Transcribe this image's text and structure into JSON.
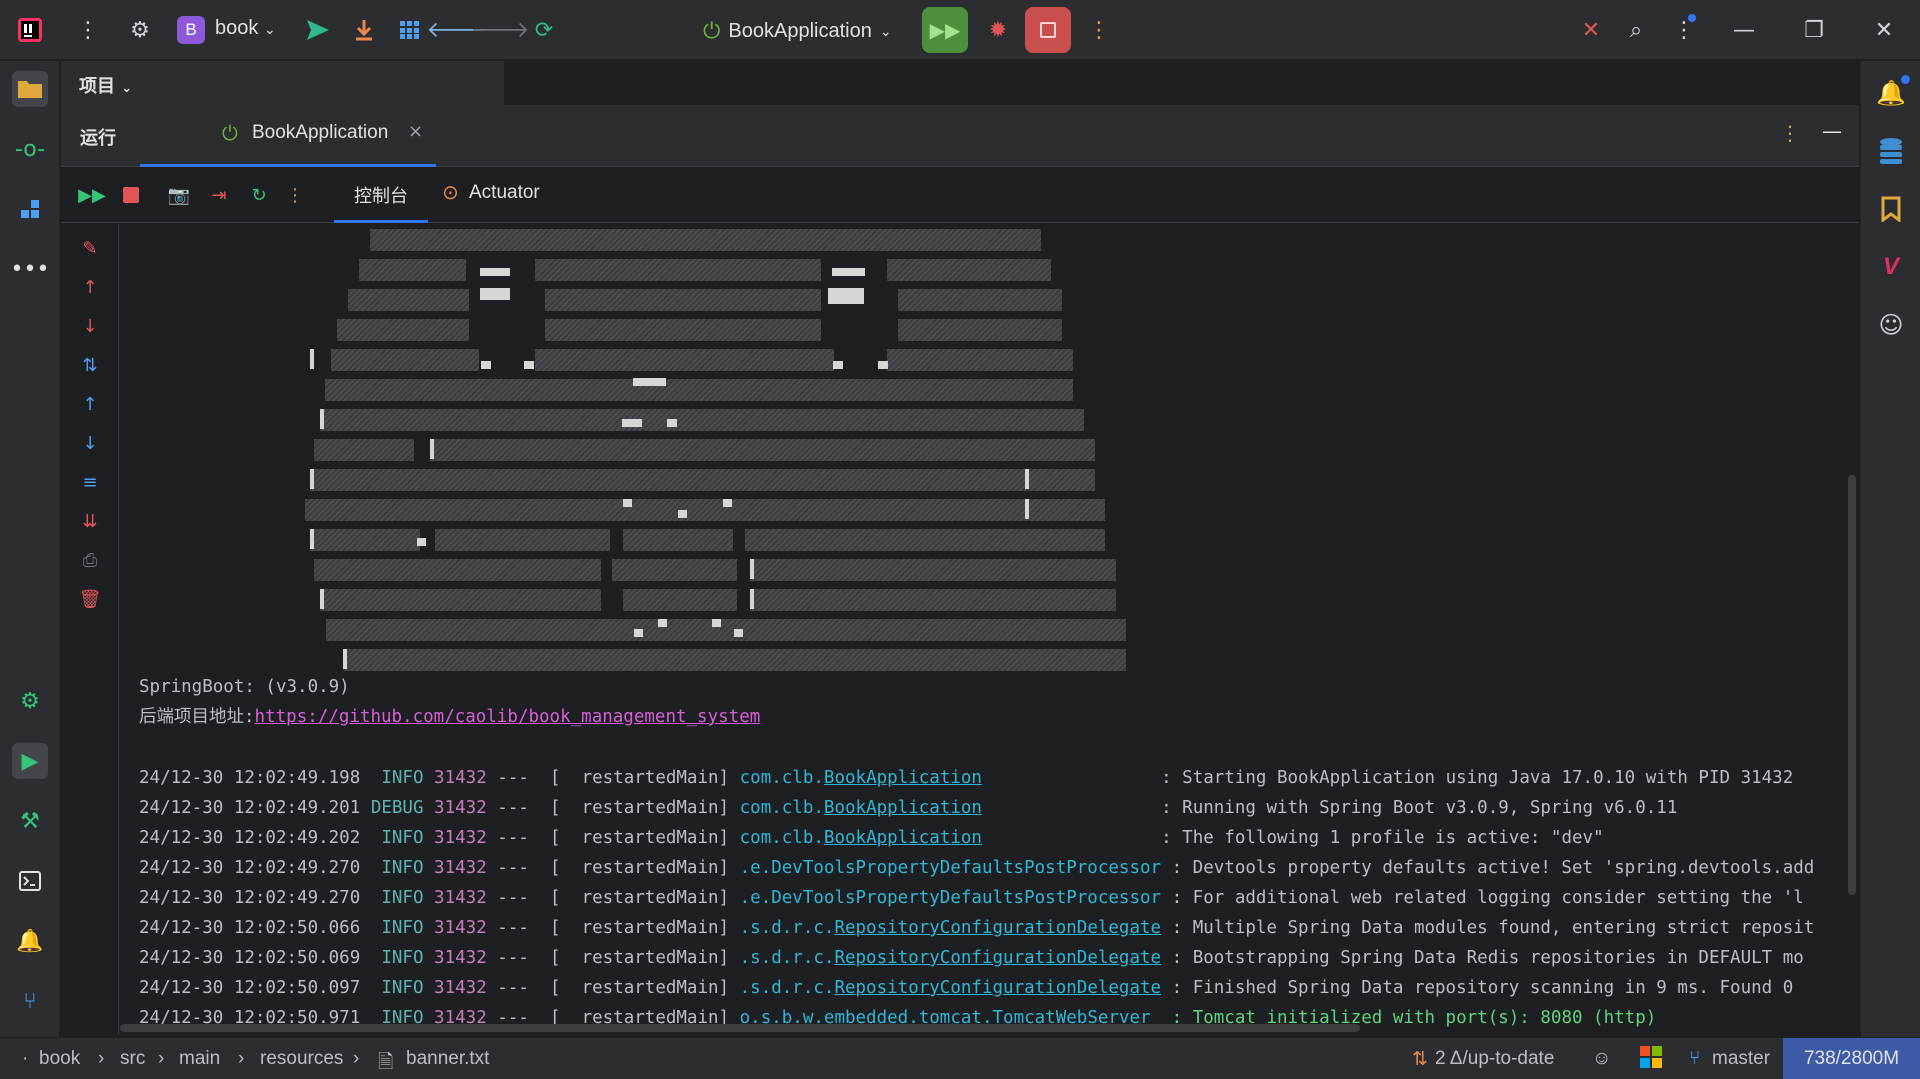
{
  "titlebar": {
    "project_initial": "B",
    "project_name": "book",
    "run_config": "BookApplication"
  },
  "project_panel": {
    "label": "项目"
  },
  "run_panel": {
    "label": "运行",
    "tab_label": "BookApplication",
    "tab_close": "×"
  },
  "console_tabs": {
    "console": "控制台",
    "actuator": "Actuator"
  },
  "console": {
    "springboot_line": "SpringBoot: (v3.0.9)",
    "backend_label": "后端项目地址:",
    "backend_url": "https://github.com/caolib/book_management_system",
    "log_lines": [
      {
        "ts": "24/12-30 12:02:49.198",
        "level": " INFO",
        "pid": "31432",
        "thread": "---  [  restartedMain]",
        "logger_prefix": "com.clb.",
        "logger_link": "BookApplication",
        "logger_pad": "                 ",
        "message": ": Starting BookApplication using Java 17.0.10 with PID 31432",
        "msg_green": false
      },
      {
        "ts": "24/12-30 12:02:49.201",
        "level": "DEBUG",
        "pid": "31432",
        "thread": "---  [  restartedMain]",
        "logger_prefix": "com.clb.",
        "logger_link": "BookApplication",
        "logger_pad": "                 ",
        "message": ": Running with Spring Boot v3.0.9, Spring v6.0.11",
        "msg_green": false
      },
      {
        "ts": "24/12-30 12:02:49.202",
        "level": " INFO",
        "pid": "31432",
        "thread": "---  [  restartedMain]",
        "logger_prefix": "com.clb.",
        "logger_link": "BookApplication",
        "logger_pad": "                 ",
        "message": ": The following 1 profile is active: \"dev\"",
        "msg_green": false
      },
      {
        "ts": "24/12-30 12:02:49.270",
        "level": " INFO",
        "pid": "31432",
        "thread": "---  [  restartedMain]",
        "logger_prefix": ".e.DevToolsPropertyDefaultsPostProcessor",
        "logger_link": "",
        "logger_pad": " ",
        "message": ": Devtools property defaults active! Set 'spring.devtools.add",
        "msg_green": false
      },
      {
        "ts": "24/12-30 12:02:49.270",
        "level": " INFO",
        "pid": "31432",
        "thread": "---  [  restartedMain]",
        "logger_prefix": ".e.DevToolsPropertyDefaultsPostProcessor",
        "logger_link": "",
        "logger_pad": " ",
        "message": ": For additional web related logging consider setting the 'l",
        "msg_green": false
      },
      {
        "ts": "24/12-30 12:02:50.066",
        "level": " INFO",
        "pid": "31432",
        "thread": "---  [  restartedMain]",
        "logger_prefix": ".s.d.r.c.",
        "logger_link": "RepositoryConfigurationDelegate",
        "logger_pad": " ",
        "message": ": Multiple Spring Data modules found, entering strict reposit",
        "msg_green": false
      },
      {
        "ts": "24/12-30 12:02:50.069",
        "level": " INFO",
        "pid": "31432",
        "thread": "---  [  restartedMain]",
        "logger_prefix": ".s.d.r.c.",
        "logger_link": "RepositoryConfigurationDelegate",
        "logger_pad": " ",
        "message": ": Bootstrapping Spring Data Redis repositories in DEFAULT mo",
        "msg_green": false
      },
      {
        "ts": "24/12-30 12:02:50.097",
        "level": " INFO",
        "pid": "31432",
        "thread": "---  [  restartedMain]",
        "logger_prefix": ".s.d.r.c.",
        "logger_link": "RepositoryConfigurationDelegate",
        "logger_pad": " ",
        "message": ": Finished Spring Data repository scanning in 9 ms. Found 0",
        "msg_green": false
      },
      {
        "ts": "24/12-30 12:02:50.971",
        "level": " INFO",
        "pid": "31432",
        "thread": "---  [  restartedMain]",
        "logger_prefix": "o.s.b.w.embedded.tomcat.",
        "logger_link": "TomcatWebServer",
        "logger_pad": "  ",
        "message": ": Tomcat initialized with port(s): 8080 (http)",
        "msg_green": true
      }
    ]
  },
  "statusbar": {
    "crumbs": [
      "book",
      "src",
      "main",
      "resources",
      "banner.txt"
    ],
    "vcs_status": "2 Δ/up-to-date",
    "branch": "master",
    "memory": "738/2800M"
  },
  "colors": {
    "accent": "#3574f0",
    "run_green": "#4e8f3d",
    "stop_red": "#c94f4f",
    "log_info": "#5fb3b3",
    "log_pid": "#c77dbb",
    "log_class": "#2fb7d6",
    "link": "#d85ed8",
    "success_green": "#5fd47a"
  }
}
